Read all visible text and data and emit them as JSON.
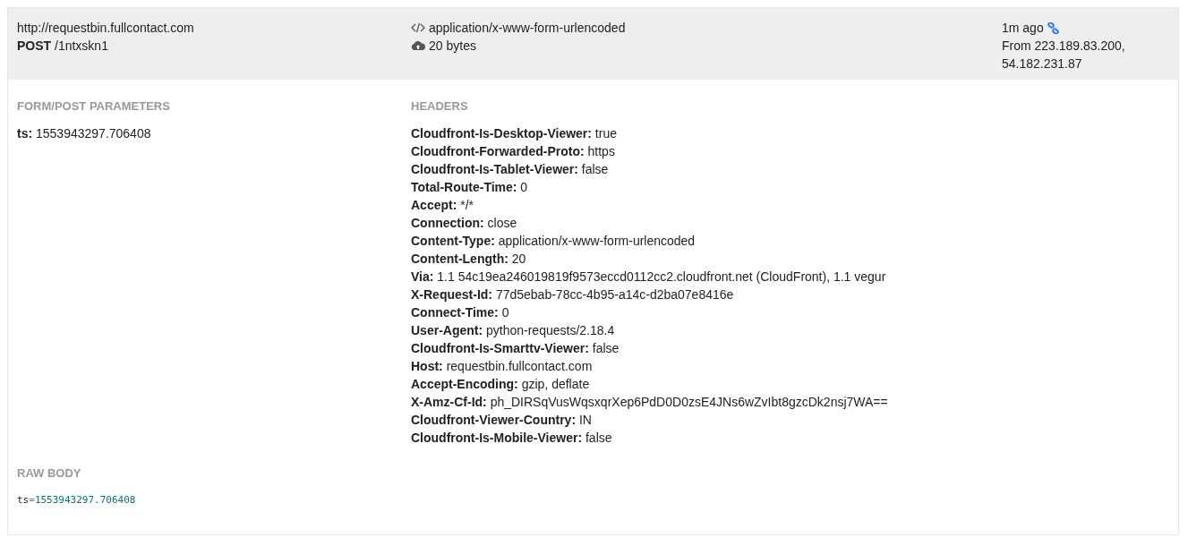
{
  "request_summary": {
    "url": "http://requestbin.fullcontact.com",
    "request_line": "**POST** /1ntxskn1",
    "content_type": "application/x-www-form-urlencoded",
    "size": "20 bytes",
    "time": "1m ago",
    "source_lines": [
      "From 223.189.83.200,",
      "54.182.231.87"
    ]
  },
  "form_parameters": {
    "title": "FORM/POST PARAMETERS",
    "items": [
      {
        "name": "ts:",
        "value": "1553943297.706408"
      }
    ]
  },
  "headers": {
    "title": "HEADERS",
    "items": [
      {
        "name": "Cloudfront-Is-Desktop-Viewer:",
        "value": "true"
      },
      {
        "name": "Cloudfront-Forwarded-Proto:",
        "value": "https"
      },
      {
        "name": "Cloudfront-Is-Tablet-Viewer:",
        "value": "false"
      },
      {
        "name": "Total-Route-Time:",
        "value": "0"
      },
      {
        "name": "Accept:",
        "value": "*/*"
      },
      {
        "name": "Connection:",
        "value": "close"
      },
      {
        "name": "Content-Type:",
        "value": "application/x-www-form-urlencoded"
      },
      {
        "name": "Content-Length:",
        "value": "20"
      },
      {
        "name": "Via:",
        "value": "1.1 54c19ea246019819f9573eccd0112cc2.cloudfront.net (CloudFront), 1.1 vegur"
      },
      {
        "name": "X-Request-Id:",
        "value": "77d5ebab-78cc-4b95-a14c-d2ba07e8416e"
      },
      {
        "name": "Connect-Time:",
        "value": "0"
      },
      {
        "name": "User-Agent:",
        "value": "python-requests/2.18.4"
      },
      {
        "name": "Cloudfront-Is-Smarttv-Viewer:",
        "value": "false"
      },
      {
        "name": "Host:",
        "value": "requestbin.fullcontact.com"
      },
      {
        "name": "Accept-Encoding:",
        "value": "gzip, deflate"
      },
      {
        "name": "X-Amz-Cf-Id:",
        "value": "ph_DIRSqVusWqsxqrXep6PdD0D0zsE4JNs6wZvIbt8gzcDk2nsj7WA=="
      },
      {
        "name": "Cloudfront-Viewer-Country:",
        "value": "IN"
      },
      {
        "name": "Cloudfront-Is-Mobile-Viewer:",
        "value": "false"
      }
    ]
  },
  "raw_body": {
    "title": "RAW BODY",
    "key": "ts",
    "operator": "=",
    "value": "1553943297.706408"
  }
}
